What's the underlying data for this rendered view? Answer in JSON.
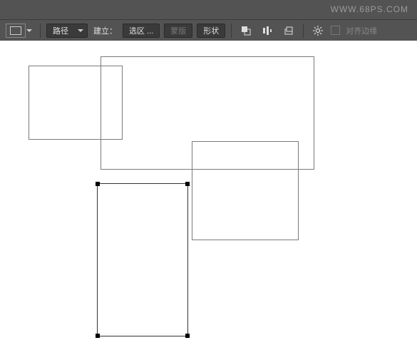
{
  "watermark": "WWW.68PS.COM",
  "toolbar": {
    "mode": "路径",
    "make_label": "建立：",
    "selection_btn": "选区 ...",
    "mask_btn": "蒙版",
    "shape_btn": "形状",
    "align_edges_label": "对齐边缘"
  },
  "canvas": {
    "rects": [
      {
        "name": "rect-1",
        "selected": false
      },
      {
        "name": "rect-2",
        "selected": false
      },
      {
        "name": "rect-3",
        "selected": false
      },
      {
        "name": "rect-4",
        "selected": true
      }
    ]
  }
}
